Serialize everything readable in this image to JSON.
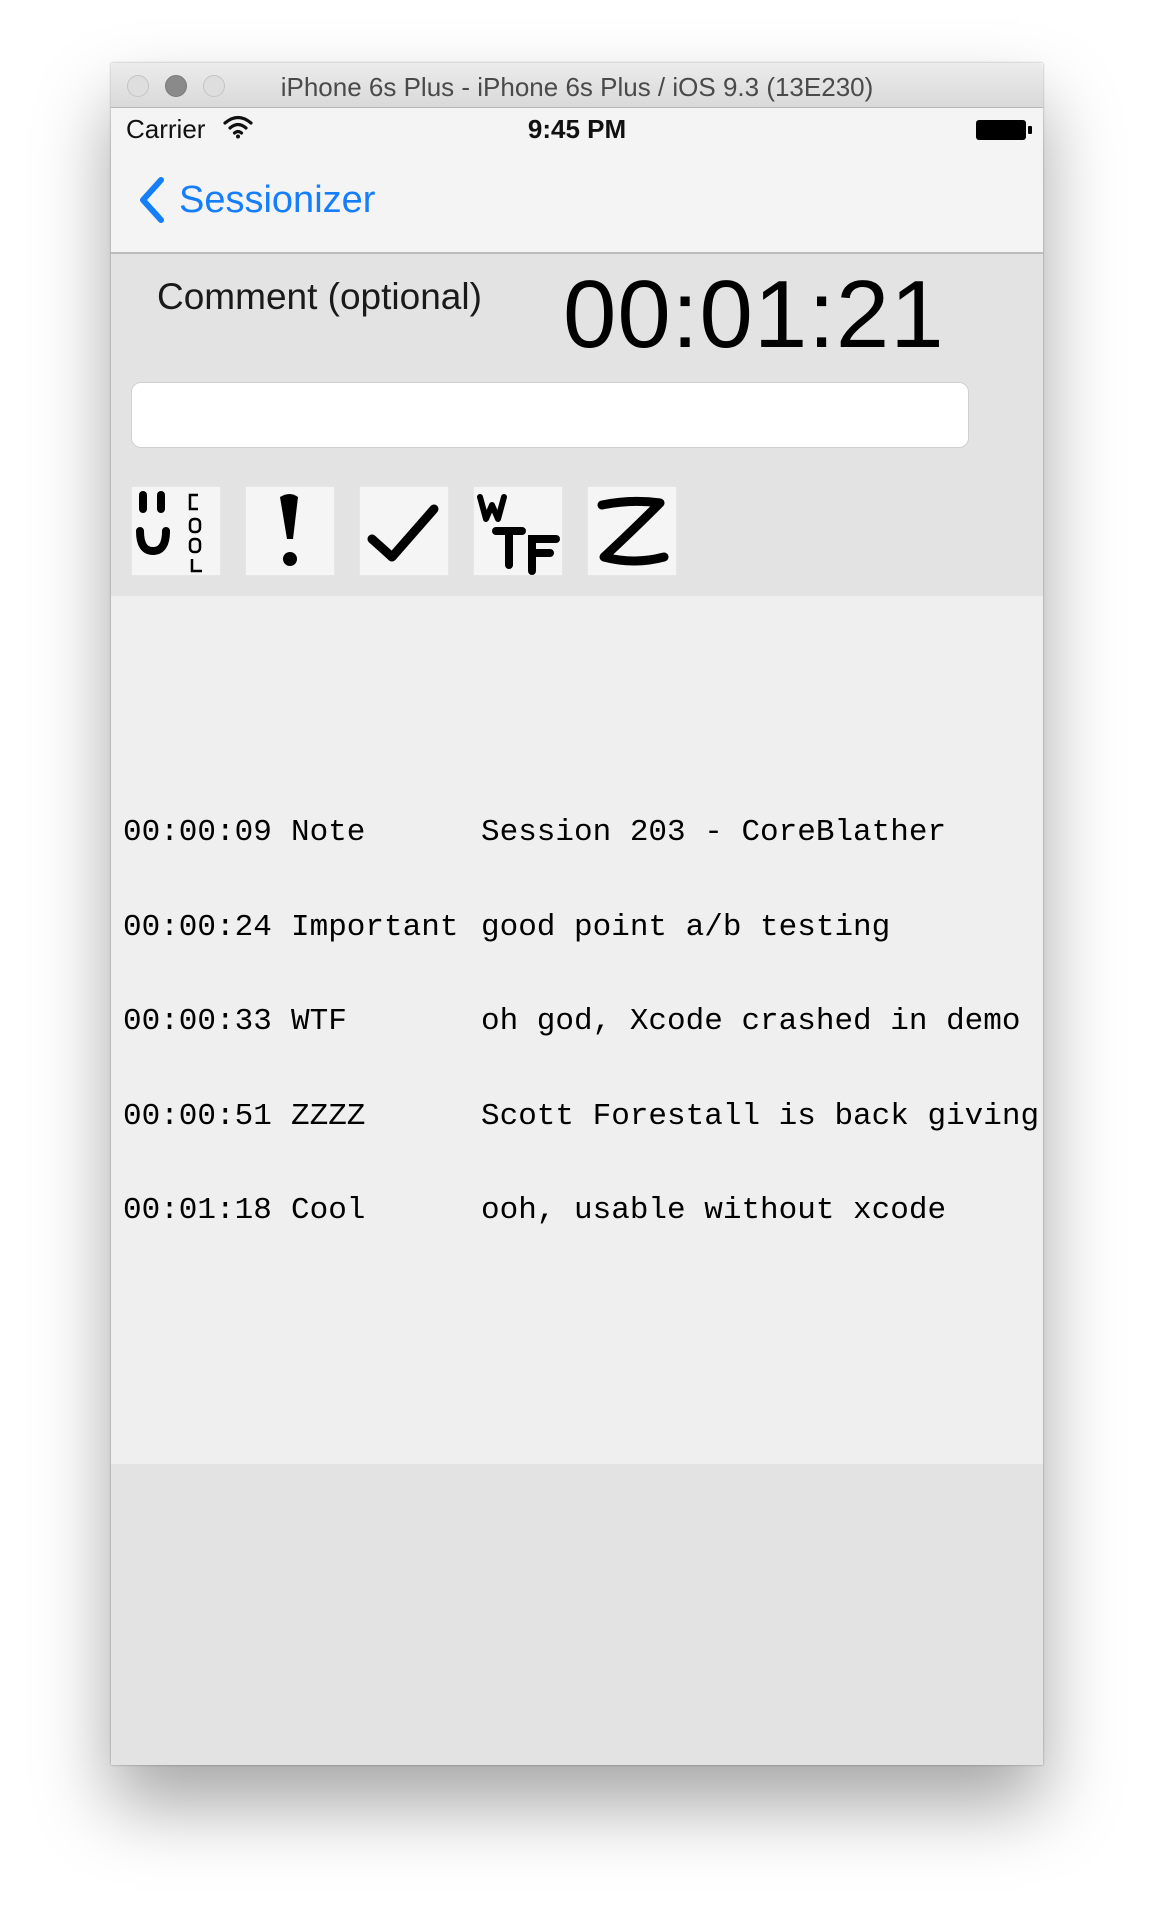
{
  "window": {
    "title": "iPhone 6s Plus - iPhone 6s Plus / iOS 9.3 (13E230)"
  },
  "status_bar": {
    "carrier": "Carrier",
    "time": "9:45 PM"
  },
  "nav": {
    "back_label": "Sessionizer"
  },
  "controls": {
    "comment_label": "Comment (optional)",
    "comment_value": "",
    "timer": "00:01:21"
  },
  "tags": [
    {
      "name": "cool",
      "icon": "cool-smiley-icon"
    },
    {
      "name": "important",
      "icon": "exclamation-icon"
    },
    {
      "name": "note",
      "icon": "checkmark-icon"
    },
    {
      "name": "wtf",
      "icon": "wtf-icon"
    },
    {
      "name": "zzzz",
      "icon": "z-icon"
    }
  ],
  "log": [
    {
      "time": "00:00:09",
      "tag": "Note",
      "text": "Session 203 - CoreBlather"
    },
    {
      "time": "00:00:24",
      "tag": "Important",
      "text": "good point a/b testing"
    },
    {
      "time": "00:00:33",
      "tag": "WTF",
      "text": "oh god, Xcode crashed in demo"
    },
    {
      "time": "00:00:51",
      "tag": "ZZZZ",
      "text": "Scott Forestall is back giving"
    },
    {
      "time": "00:01:18",
      "tag": "Cool",
      "text": "ooh, usable without xcode"
    }
  ],
  "colors": {
    "accent": "#147efb",
    "panel": "#e3e3e3",
    "background": "#efefef"
  }
}
